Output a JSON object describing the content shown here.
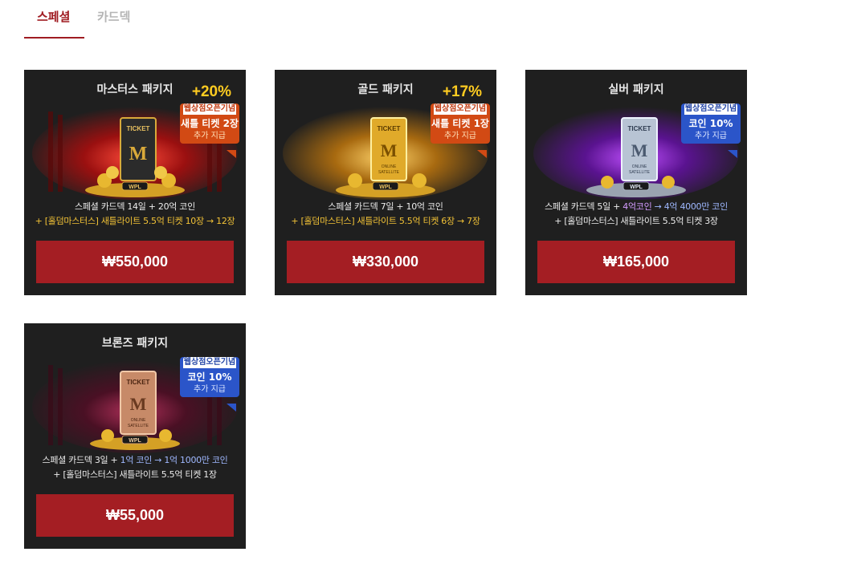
{
  "tabs": [
    {
      "label": "스페셜",
      "active": true
    },
    {
      "label": "카드덱",
      "active": false
    }
  ],
  "colors": {
    "accent": "#a01c22",
    "button": "#a41e23",
    "card_bg": "#1f1f1f",
    "gold_text": "#f2c236"
  },
  "packages": [
    {
      "title": "마스터스 패키지",
      "bonus": "+20%",
      "badge": {
        "top": "웹상점오픈기념",
        "main": "새틀 티켓 2장",
        "sub": "추가 지급",
        "color": "orange"
      },
      "line1": "스페셜 카드덱 14일 + 20억 코인",
      "line2": "+ [홀덤마스터스] 새틀라이트 5.5억 티켓 10장 → 12장",
      "price": "₩550,000",
      "theme": "red"
    },
    {
      "title": "골드 패키지",
      "bonus": "+17%",
      "badge": {
        "top": "웹상점오픈기념",
        "main": "새틀 티켓 1장",
        "sub": "추가 지급",
        "color": "orange"
      },
      "line1": "스페셜 카드덱 7일 + 10억 코인",
      "line2": "+ [홀덤마스터스] 새틀라이트 5.5억 티켓 6장 → 7장",
      "price": "₩330,000",
      "theme": "gold"
    },
    {
      "title": "실버 패키지",
      "bonus": "",
      "badge": {
        "top": "웹상점오픈기념",
        "main": "코인 10%",
        "sub": "추가 지급",
        "color": "blue"
      },
      "line1a": "스페셜 카드덱 5일 + ",
      "line1b": "4억코인",
      "line1c": " → 4억 4000만 코인",
      "line2": "+ [홀덤마스터스] 새틀라이트 5.5억 티켓 3장",
      "price": "₩165,000",
      "theme": "purple"
    },
    {
      "title": "브론즈 패키지",
      "bonus": "",
      "badge": {
        "top": "웹상점오픈기념",
        "main": "코인 10%",
        "sub": "추가 지급",
        "color": "blue"
      },
      "line1a": "스페셜 카드덱 3일 + ",
      "line1b": "1억 코인",
      "line1c": " → 1억 1000만 코인",
      "line2": "+ [홀덤마스터스] 새틀라이트 5.5억 티켓 1장",
      "price": "₩55,000",
      "theme": "bronze"
    }
  ],
  "ticket": {
    "label": "TICKET",
    "sub1": "ONLINE",
    "sub2": "SATELLITE",
    "logo": "WPL"
  }
}
